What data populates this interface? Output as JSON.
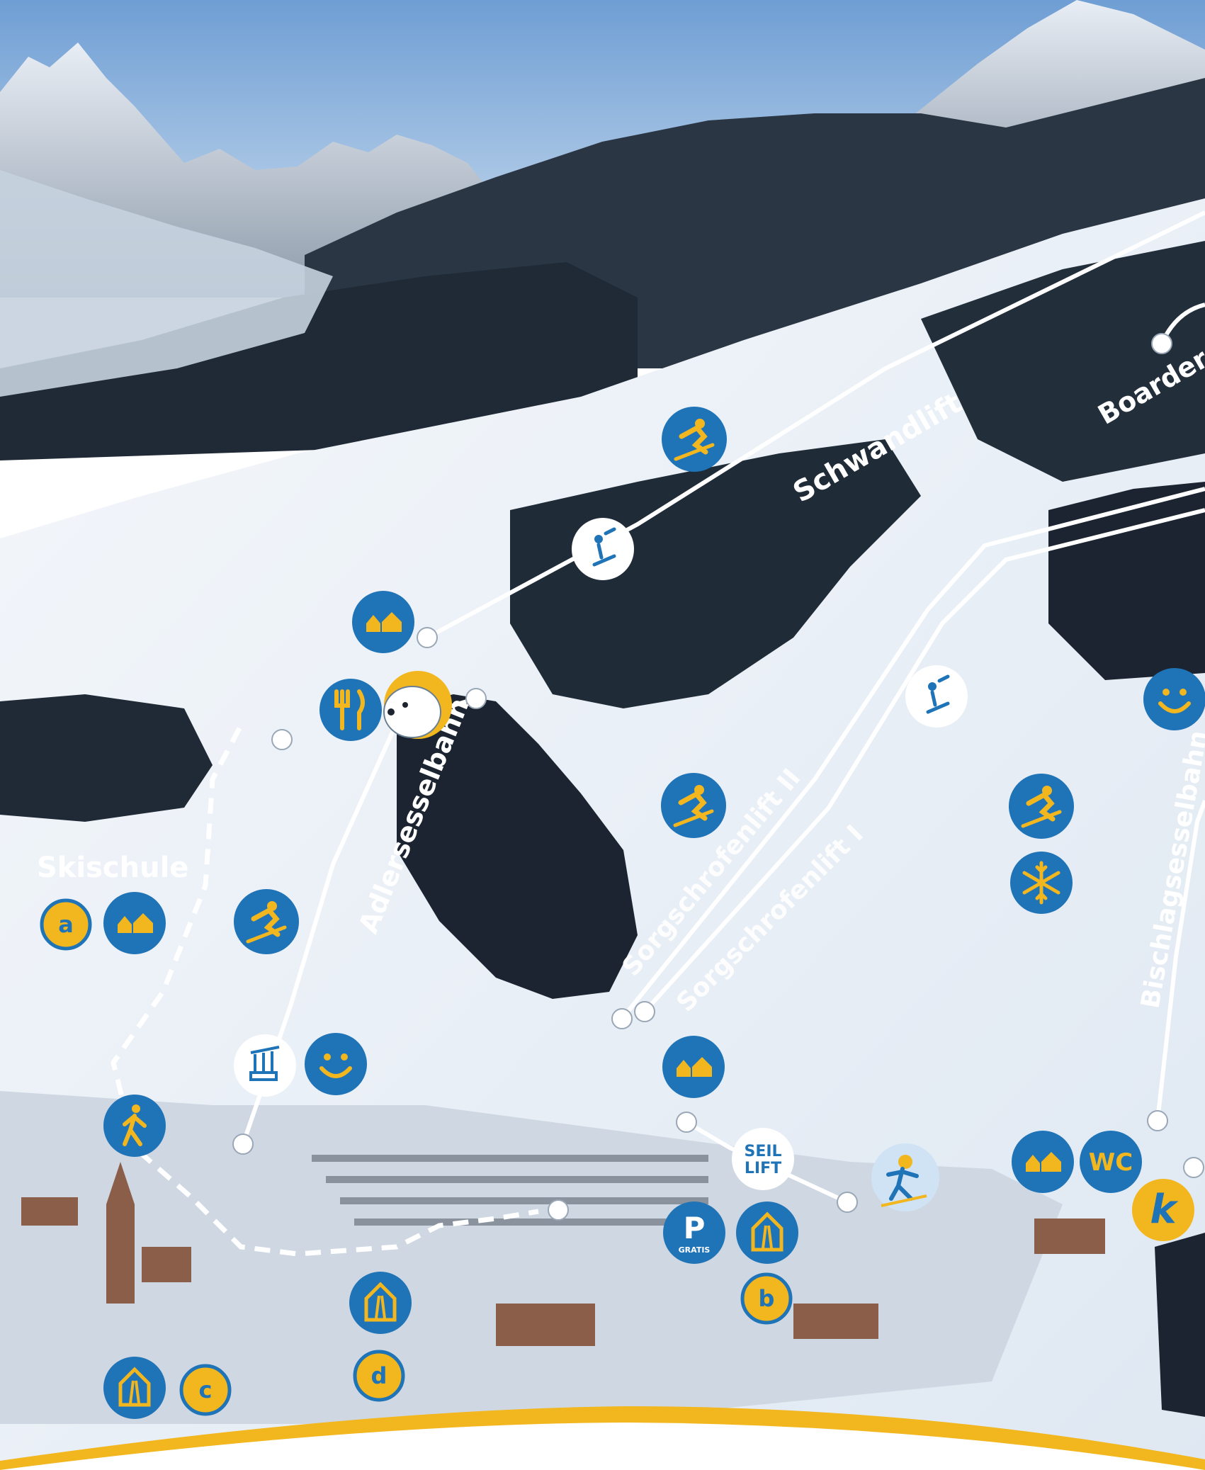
{
  "colors": {
    "sky_top": "#6f9ed4",
    "sky_bottom": "#c9dcee",
    "snow": "#eef3f8",
    "forest": "#1d2530",
    "icon_blue": "#1f73b7",
    "accent_yellow": "#f2b61f",
    "line_white": "#ffffff"
  },
  "lifts": [
    {
      "name": "Schwandlift"
    },
    {
      "name": "Boarder-"
    },
    {
      "name": "Adlersesselbahn"
    },
    {
      "name": "Sorgschrofenlift II"
    },
    {
      "name": "Sorgschrofenlift I"
    },
    {
      "name": "Bischlagsesselbahn"
    }
  ],
  "labels": {
    "skischule": "Skischule",
    "seillift": "SEIL\nLIFT",
    "parking_main": "P",
    "parking_sub": "GRATIS",
    "wc": "WC",
    "k": "k"
  },
  "letter_badges": [
    "a",
    "b",
    "c",
    "d"
  ],
  "icons": [
    "skier-icon",
    "skier-icon",
    "skier-icon",
    "skier-icon",
    "drag-lift-icon",
    "drag-lift-icon",
    "chairlift-icon",
    "hut-icon",
    "hut-icon",
    "hut-icon",
    "hut-icon",
    "restaurant-icon",
    "smiley-icon",
    "smiley-icon",
    "snowflake-icon",
    "hiker-icon",
    "ski-rental-icon",
    "polar-bear-mascot",
    "skier-mascot"
  ]
}
